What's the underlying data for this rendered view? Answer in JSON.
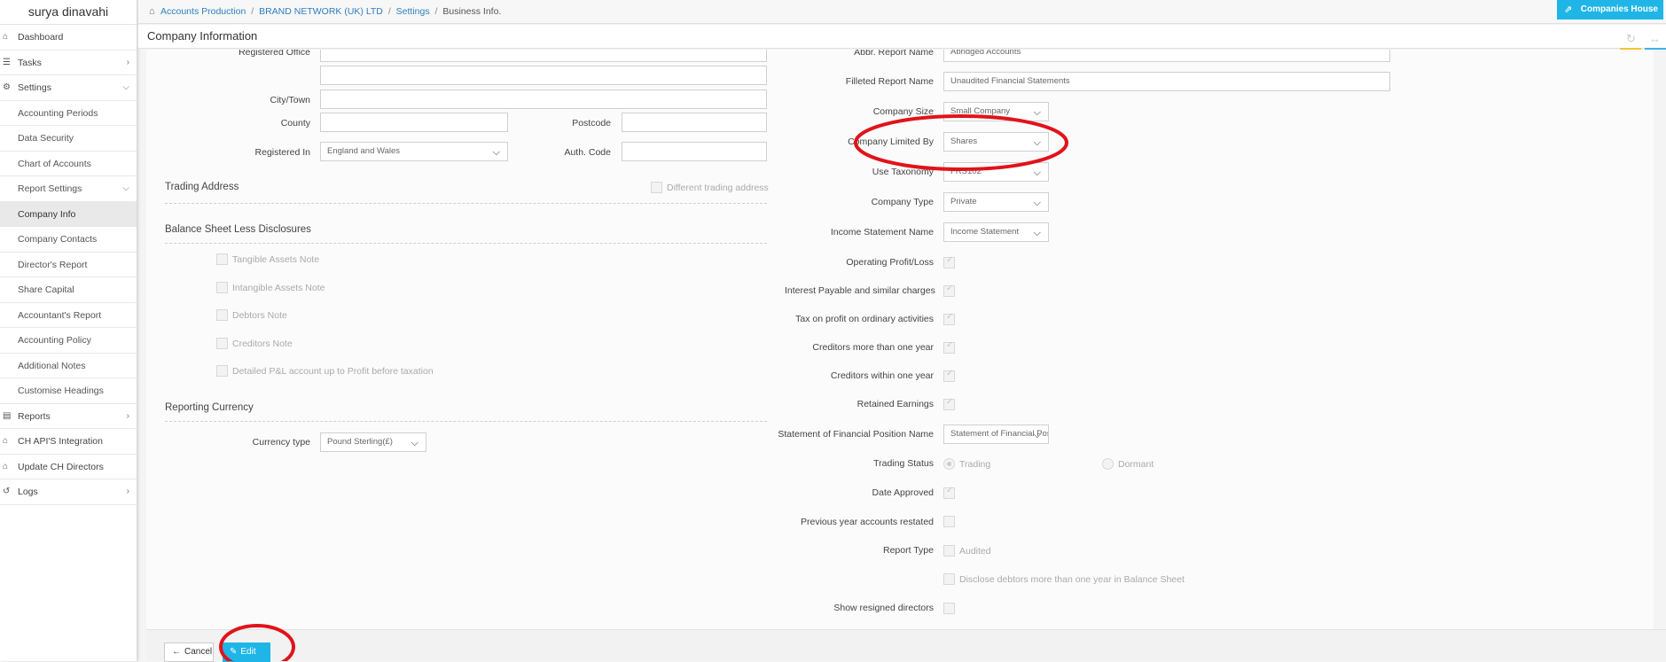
{
  "sidebar": {
    "user_name": "surya dinavahi",
    "items": [
      {
        "label": "Dashboard",
        "icon": "dashboard-icon",
        "glyph": "⌂"
      },
      {
        "label": "Tasks",
        "icon": "tasks-icon",
        "glyph": "☰",
        "chevron": "›"
      },
      {
        "label": "Settings",
        "icon": "gear-icon",
        "glyph": "⚙",
        "chevron": "⌵"
      }
    ],
    "settings_sub": [
      "Accounting Periods",
      "Data Security",
      "Chart of Accounts",
      "Report Settings"
    ],
    "report_settings_chevron": "⌵",
    "report_sub": [
      "Company Info",
      "Company Contacts",
      "Director's Report",
      "Share Capital",
      "Accountant's Report",
      "Accounting Policy",
      "Additional Notes",
      "Customise Headings"
    ],
    "bottom_items": [
      {
        "label": "Reports",
        "icon": "reports-icon",
        "glyph": "▤",
        "chevron": "›"
      },
      {
        "label": "CH API'S Integration",
        "icon": "home-icon",
        "glyph": "⌂"
      },
      {
        "label": "Update CH Directors",
        "icon": "home-icon",
        "glyph": "⌂"
      },
      {
        "label": "Logs",
        "icon": "history-icon",
        "glyph": "↺",
        "chevron": "›"
      }
    ]
  },
  "breadcrumb": {
    "home_glyph": "⌂",
    "links": [
      "Accounts Production",
      "BRAND NETWORK (UK) LTD",
      "Settings"
    ],
    "current": "Business Info.",
    "separator": "/"
  },
  "companies_house_button": {
    "label": "Companies House",
    "glyph": "⇗"
  },
  "title_bar": {
    "title": "Company Information",
    "refresh_glyph": "↻",
    "expand_glyph": "↔",
    "accent_yellow": "#f4c430",
    "accent_blue": "#3bb4e8"
  },
  "left": {
    "registered_office_label": "Registered Office",
    "city_label": "City/Town",
    "county_label": "County",
    "postcode_label": "Postcode",
    "registered_in_label": "Registered In",
    "registered_in_value": "England and Wales",
    "auth_code_label": "Auth. Code",
    "trading_address_title": "Trading Address",
    "different_trading_label": "Different trading address",
    "balance_sheet_title": "Balance Sheet Less Disclosures",
    "balance_items": [
      "Tangible Assets Note",
      "Intangible Assets Note",
      "Debtors Note",
      "Creditors Note",
      "Detailed P&L account up to Profit before taxation"
    ],
    "reporting_currency_title": "Reporting Currency",
    "currency_type_label": "Currency type",
    "currency_type_value": "Pound Sterling(£)"
  },
  "right": {
    "abbr_report_name_label": "Abbr. Report Name",
    "abbr_report_name_value": "Abridged Accounts",
    "filleted_report_name_label": "Filleted Report Name",
    "filleted_report_name_value": "Unaudited Financial Statements",
    "company_size_label": "Company Size",
    "company_size_value": "Small Company",
    "company_limited_by_label": "Company Limited By",
    "company_limited_by_value": "Shares",
    "use_taxonomy_label": "Use Taxonomy",
    "use_taxonomy_value": "FRS102",
    "company_type_label": "Company Type",
    "company_type_value": "Private",
    "income_statement_name_label": "Income Statement Name",
    "income_statement_name_value": "Income Statement",
    "checks": [
      {
        "label": "Operating Profit/Loss",
        "checked": true
      },
      {
        "label": "Interest Payable and similar charges",
        "checked": true
      },
      {
        "label": "Tax on profit on ordinary activities",
        "checked": true
      },
      {
        "label": "Creditors more than one year",
        "checked": true
      },
      {
        "label": "Creditors within one year",
        "checked": true
      },
      {
        "label": "Retained Earnings",
        "checked": true
      }
    ],
    "sofp_name_label": "Statement of Financial Position Name",
    "sofp_name_value": "Statement of Financial Position",
    "trading_status_label": "Trading Status",
    "trading_option": "Trading",
    "dormant_option": "Dormant",
    "date_approved_label": "Date Approved",
    "prev_year_label": "Previous year accounts restated",
    "report_type_label": "Report Type",
    "audited_label": "Audited",
    "disclose_debtors_label": "Disclose debtors more than one year in Balance Sheet",
    "show_resigned_label": "Show resigned directors",
    "caret_glyph": "⌵"
  },
  "footer": {
    "cancel_label": "Cancel",
    "cancel_glyph": "←",
    "edit_label": "Edit",
    "edit_glyph": "✎"
  },
  "colors": {
    "accent": "#1fb5e7",
    "link": "#2e7fbf",
    "annotation": "#e0131b"
  }
}
